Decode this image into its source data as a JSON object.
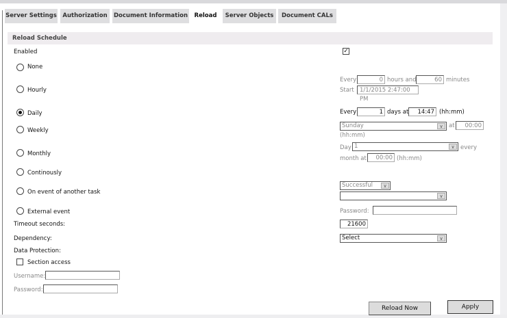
{
  "tabs": [
    "Server Settings",
    "Authorization",
    "Document Information",
    "Reload",
    "Server Objects",
    "Document CALs"
  ],
  "section_title": "Reload Schedule",
  "enabled_label": "Enabled",
  "enabled_checked": true,
  "options": [
    "None",
    "Hourly",
    "Daily",
    "Weekly",
    "Monthly",
    "Continously",
    "On event of another task",
    "External event"
  ],
  "selected_option": "Daily",
  "hourly": {
    "every": "Every",
    "hours": "0",
    "hours_and": "hours and",
    "minutes": "60",
    "minutes_label": "minutes",
    "start": "Start",
    "start_value": "1/1/2015 2:47:00 PM"
  },
  "daily": {
    "every": "Every",
    "days": "1",
    "days_at": "days at",
    "time": "14:47",
    "hhmm": "(hh:mm)"
  },
  "weekly": {
    "day": "Sunday",
    "at": "at",
    "time": "00:00",
    "hhmm": "(hh:mm)"
  },
  "monthly": {
    "day_label": "Day",
    "day": "1",
    "every": "every",
    "month_at": "month at",
    "time": "00:00",
    "hhmm": "(hh:mm)"
  },
  "on_event": {
    "status": "Successful",
    "task": ""
  },
  "external": {
    "password_label": "Password:",
    "password": ""
  },
  "timeout_label": "Timeout seconds:",
  "timeout_value": "21600",
  "dependency_label": "Dependency:",
  "dependency_value": "Select",
  "data_protection_label": "Data Protection:",
  "section_access_label": "Section access",
  "username_label": "Username:",
  "password_label": "Password:",
  "buttons": {
    "reload_now": "Reload Now",
    "apply": "Apply"
  }
}
